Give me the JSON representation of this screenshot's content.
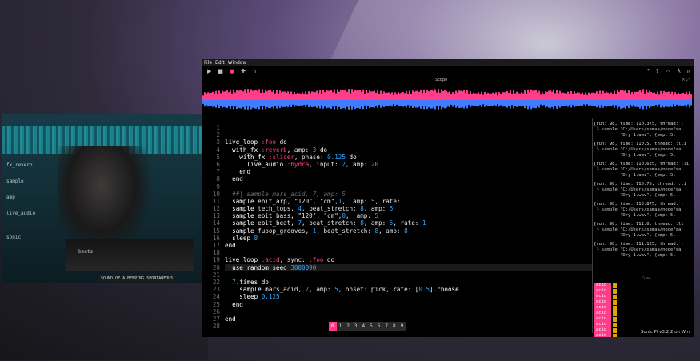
{
  "menubar": {
    "items": [
      "File",
      "Edit",
      "Window"
    ]
  },
  "toolbar": {
    "left_icons": [
      "play-icon",
      "stop-icon",
      "record-icon",
      "plus-icon",
      "undo-icon"
    ],
    "right_icons": [
      "text-size-icon",
      "help-icon",
      "scope-icon",
      "lambda-icon",
      "pi-icon"
    ]
  },
  "scope": {
    "title": "Scope",
    "controls": "× ⤢"
  },
  "editor": {
    "line_numbers": [
      "1",
      "2",
      "3",
      "4",
      "5",
      "6",
      "7",
      "8",
      "9",
      "10",
      "11",
      "12",
      "13",
      "14",
      "15",
      "16",
      "17",
      "18",
      "19",
      "20",
      "21",
      "22",
      "23",
      "24",
      "25",
      "26",
      "27",
      "28"
    ],
    "lines": [
      "",
      "",
      "live_loop :foo do",
      "  with_fx :reverb, amp: 3 do",
      "    with_fx :slicer, phase: 0.125 do",
      "      live_audio :hydra, input: 2, amp: 20",
      "    end",
      "  end",
      "",
      "  ##| sample mars_acid, 7, amp: 5",
      "  sample ebit_arp, \"120\", \"cm\",1,  amp: 5, rate: 1",
      "  sample tech_tops, 4, beat_stretch: 8, amp: 5",
      "  sample ebit_bass, \"120\", \"cm\",0,  amp: 5",
      "  sample ebit_beat, 7, beat_stretch: 8, amp: 5, rate: 1",
      "  sample fupop_grooves, 1, beat_stretch: 8, amp: 8",
      "  sleep 8",
      "end",
      "",
      "live_loop :acid, sync: :foo do",
      "  use_random_seed 3000090",
      "",
      "  7.times do",
      "    sample mars_acid, 7, amp: 5, onset: pick, rate: [0.5].choose",
      "    sleep 0.125",
      "  end",
      "",
      "end",
      ""
    ]
  },
  "buffers": [
    "0",
    "1",
    "2",
    "3",
    "4",
    "5",
    "6",
    "7",
    "8",
    "9"
  ],
  "active_buffer": "0",
  "log": [
    {
      "head": "{run: 98, time: 110.375, thread: :",
      "sub1": " └ sample \"C:/Users/samaa/node/sa",
      "sub2": "          \"Dry 1.wav\", {amp: 5,"
    },
    {
      "head": "{run: 98, time: 110.5, thread: :lli",
      "sub1": " └ sample \"C:/Users/samaa/node/sa",
      "sub2": "          \"Dry 1.wav\", {amp: 5,"
    },
    {
      "head": "{run: 98, time: 110.625, thread: :li",
      "sub1": " └ sample \"C:/Users/samaa/node/sa",
      "sub2": "          \"Dry 1.wav\", {amp: 5,"
    },
    {
      "head": "{run: 98, time: 110.75, thread: :li",
      "sub1": " └ sample \"C:/Users/samaa/node/sa",
      "sub2": "          \"Dry 1.wav\", {amp: 5,"
    },
    {
      "head": "{run: 98, time: 110.875, thread: :",
      "sub1": " └ sample \"C:/Users/samaa/node/sa",
      "sub2": "          \"Dry 1.wav\", {amp: 5,"
    },
    {
      "head": "{run: 98, time: 111.0, thread: :li",
      "sub1": " └ sample \"C:/Users/samaa/node/sa",
      "sub2": "          \"Dry 1.wav\", {amp: 5,"
    },
    {
      "head": "{run: 98, time: 111.125, thread: :",
      "sub1": " └ sample \"C:/Users/samaa/node/sa",
      "sub2": "          \"Dry 1.wav\", {amp: 5,"
    }
  ],
  "cues": {
    "title": "Cues",
    "items": [
      "acid",
      "acid",
      "acid",
      "acid",
      "acid",
      "acid",
      "acid",
      "acid",
      "acid",
      "acid"
    ]
  },
  "version": "Sonic Pi v3.2.2 on Win",
  "webcam": {
    "caption": "SOUND OF A BEEPING SPONTANEOUS",
    "overlay_texts": [
      "fx_reverb",
      "sample",
      "amp",
      "live_audio",
      "beats",
      "sonic"
    ]
  },
  "colors": {
    "accent_pink": "#ff3d8b",
    "accent_blue": "#30a8ff",
    "cue_bar": "#e2a400"
  }
}
